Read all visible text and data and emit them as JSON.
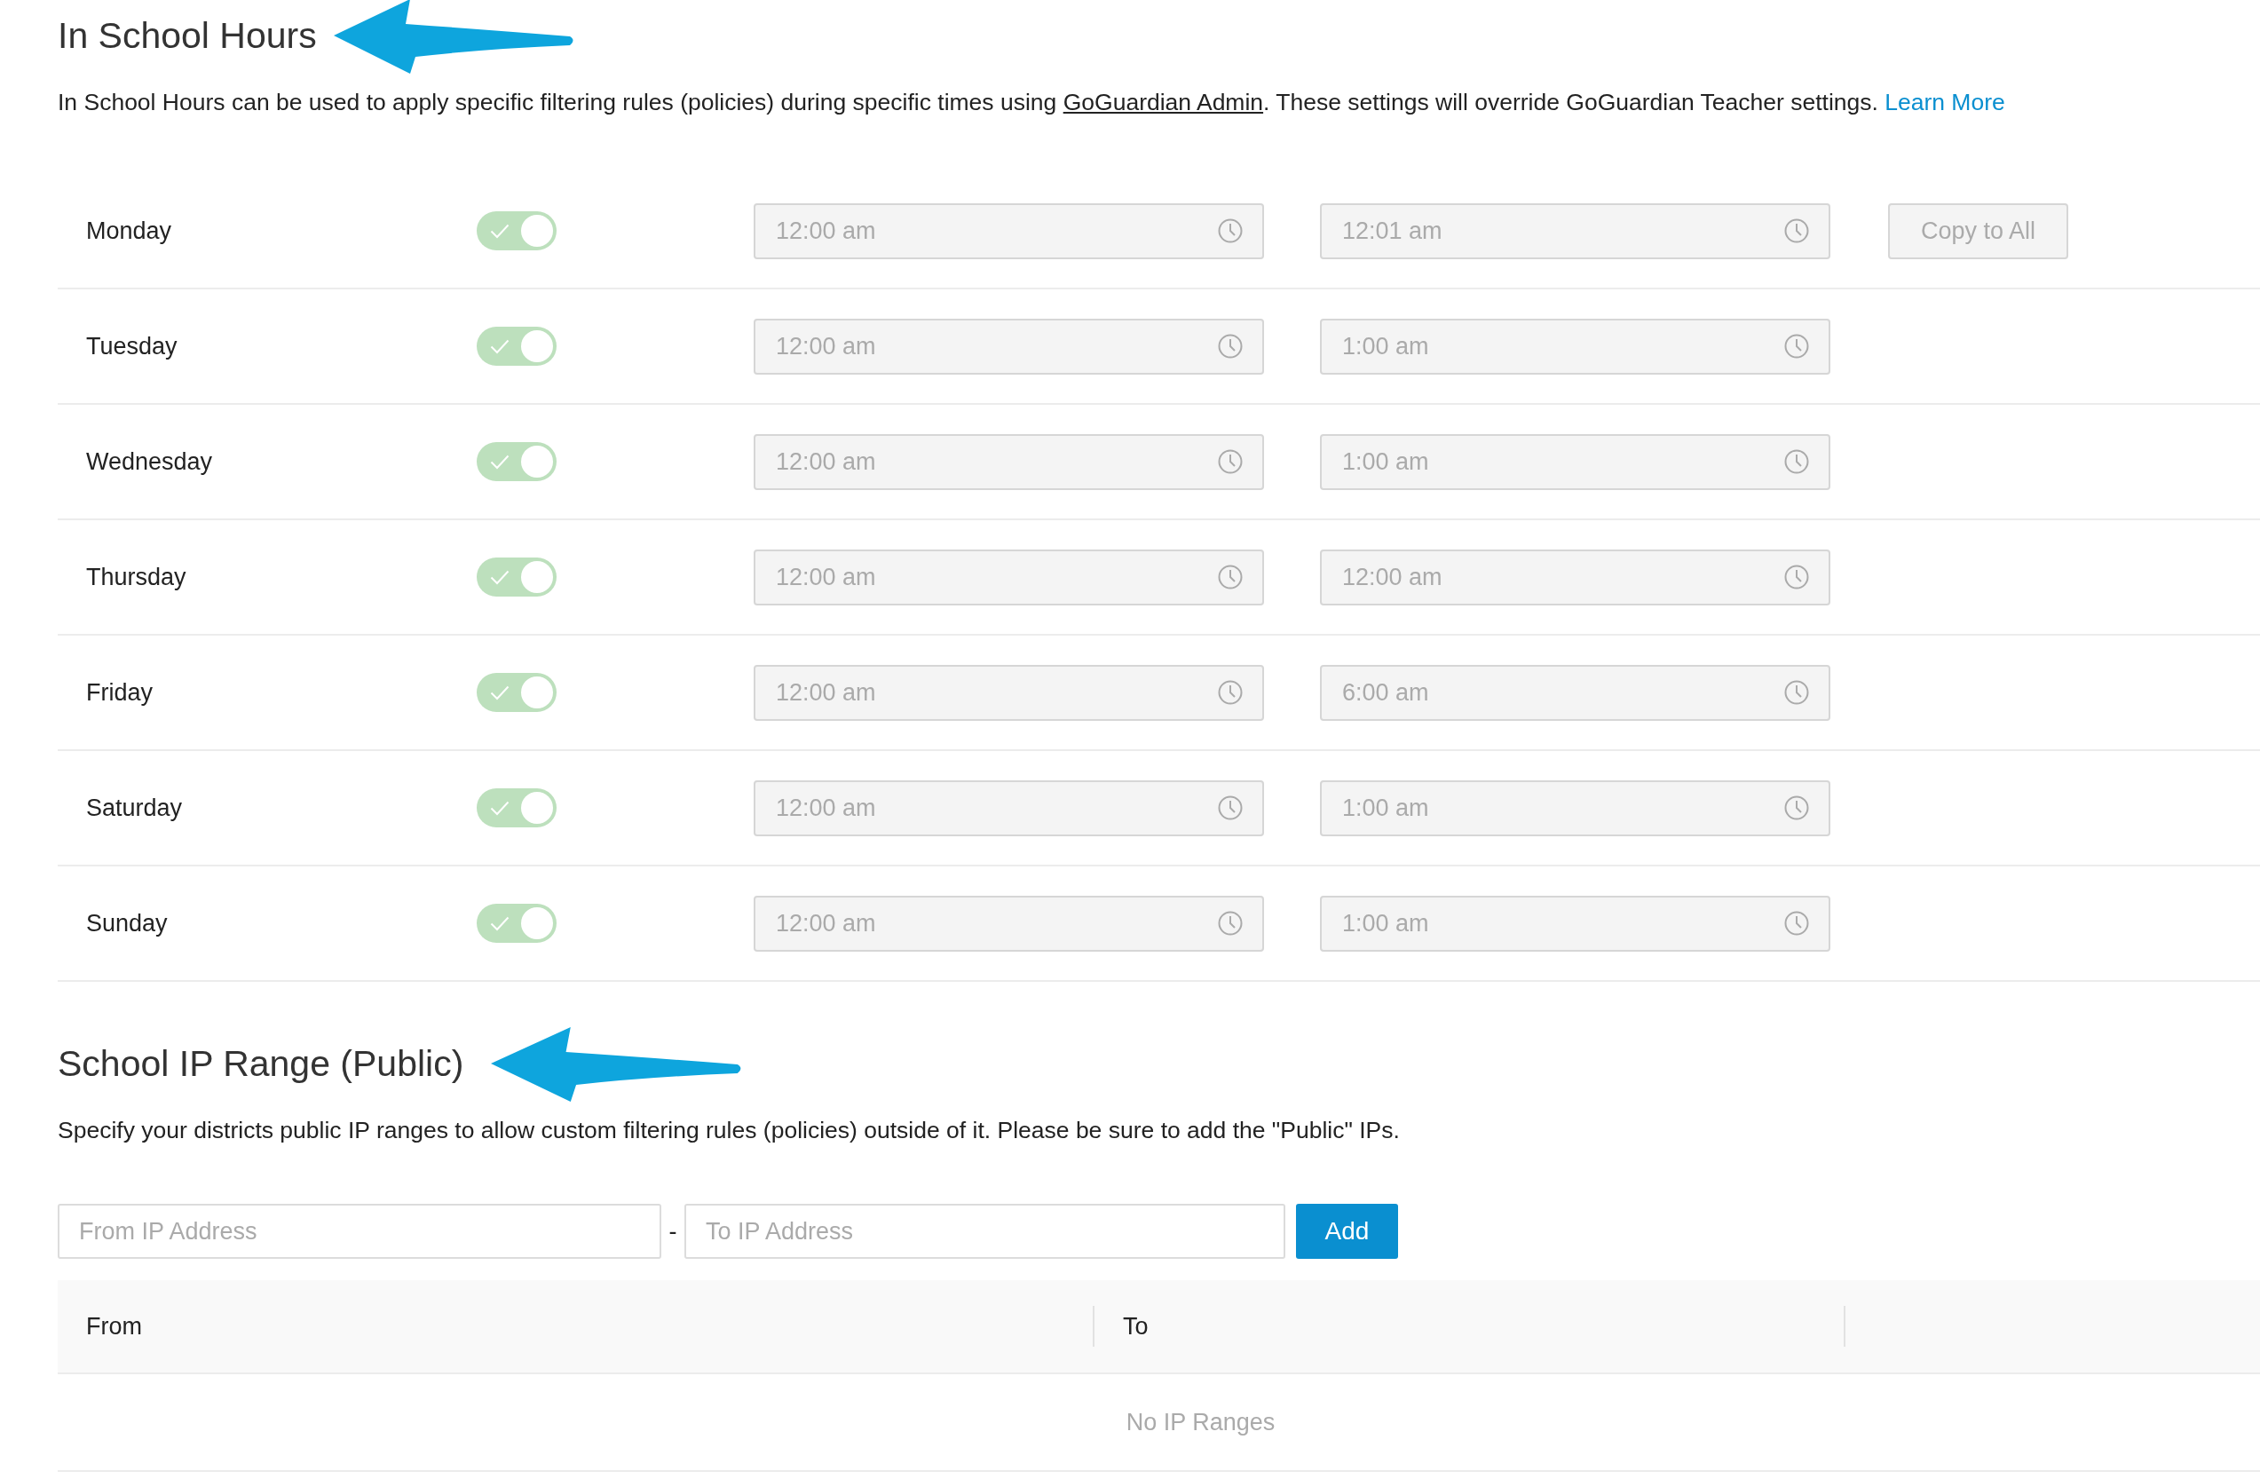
{
  "school_hours": {
    "title": "In School Hours",
    "description": [
      {
        "kind": "text",
        "text": "In School Hours can be used to apply specific filtering rules (policies) during specific times using "
      },
      {
        "kind": "link",
        "text": "GoGuardian Admin"
      },
      {
        "kind": "text",
        "text": ". These settings will override GoGuardian Teacher settings. "
      },
      {
        "kind": "more",
        "text": "Learn More"
      }
    ],
    "fields_disabled": true,
    "copy_button": {
      "label": "Copy to All",
      "disabled": true
    },
    "days": [
      {
        "day": "Monday",
        "on": true,
        "start": "12:00 am",
        "end": "12:01 am"
      },
      {
        "day": "Tuesday",
        "on": true,
        "start": "12:00 am",
        "end": "1:00 am"
      },
      {
        "day": "Wednesday",
        "on": true,
        "start": "12:00 am",
        "end": "1:00 am"
      },
      {
        "day": "Thursday",
        "on": true,
        "start": "12:00 am",
        "end": "12:00 am"
      },
      {
        "day": "Friday",
        "on": true,
        "start": "12:00 am",
        "end": "6:00 am"
      },
      {
        "day": "Saturday",
        "on": true,
        "start": "12:00 am",
        "end": "1:00 am"
      },
      {
        "day": "Sunday",
        "on": true,
        "start": "12:00 am",
        "end": "1:00 am"
      }
    ]
  },
  "ip_range": {
    "title": "School IP Range (Public)",
    "description": "Specify your districts public IP ranges to allow custom filtering rules (policies) outside of it. Please be sure to add the \"Public\" IPs.",
    "from_field": {
      "placeholder": "From IP Address"
    },
    "separator": "-",
    "to_field": {
      "placeholder": "To IP Address"
    },
    "add_button": "Add",
    "table": {
      "columns": [
        "From",
        "To"
      ],
      "empty_message": "No IP Ranges"
    }
  }
}
